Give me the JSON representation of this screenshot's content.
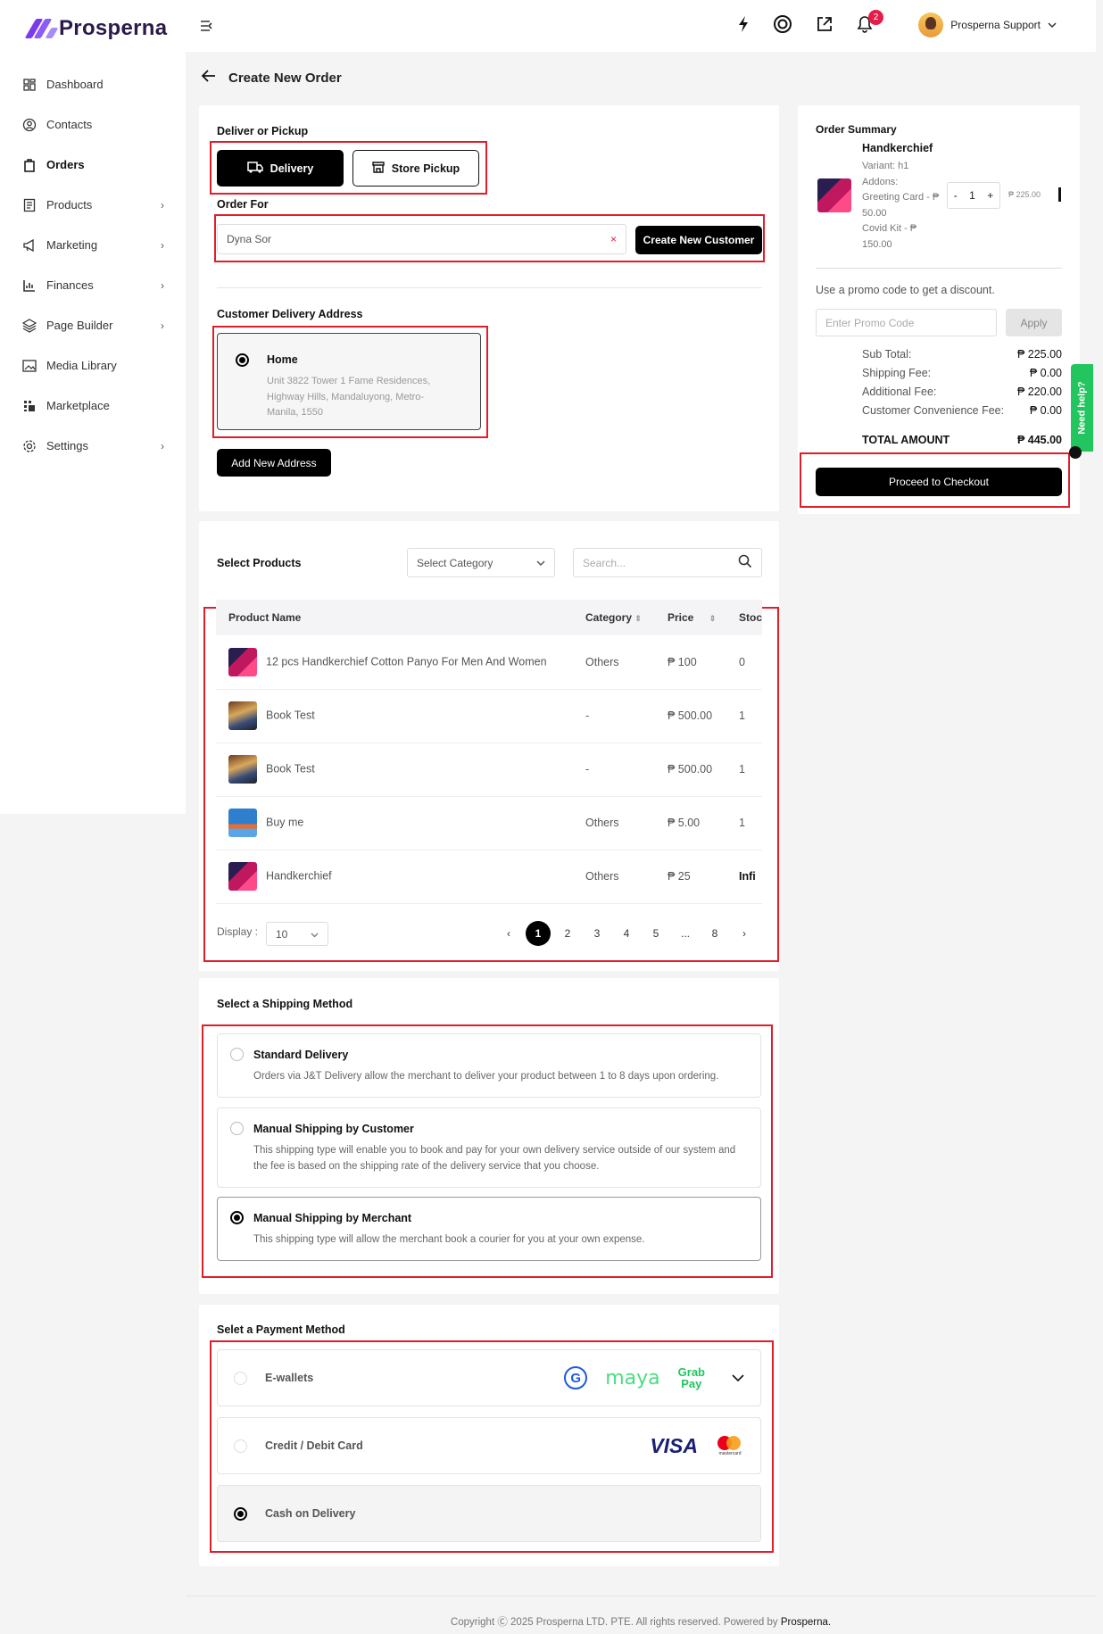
{
  "brand": {
    "name": "Prosperna"
  },
  "sidebar": {
    "items": [
      {
        "label": "Dashboard",
        "icon": "dashboard-icon",
        "chevron": false
      },
      {
        "label": "Contacts",
        "icon": "contacts-icon",
        "chevron": false
      },
      {
        "label": "Orders",
        "icon": "orders-icon",
        "chevron": false,
        "active": true
      },
      {
        "label": "Products",
        "icon": "products-icon",
        "chevron": true
      },
      {
        "label": "Marketing",
        "icon": "megaphone-icon",
        "chevron": true
      },
      {
        "label": "Finances",
        "icon": "chart-icon",
        "chevron": true
      },
      {
        "label": "Page Builder",
        "icon": "layers-icon",
        "chevron": true
      },
      {
        "label": "Media Library",
        "icon": "image-icon",
        "chevron": false
      },
      {
        "label": "Marketplace",
        "icon": "grid-icon",
        "chevron": false
      },
      {
        "label": "Settings",
        "icon": "gear-icon",
        "chevron": true
      }
    ]
  },
  "topbar": {
    "notification_count": "2",
    "user_name": "Prosperna Support"
  },
  "page": {
    "title": "Create New Order"
  },
  "deliver": {
    "title": "Deliver or Pickup",
    "delivery_label": "Delivery",
    "pickup_label": "Store Pickup",
    "order_for_title": "Order For",
    "customer_value": "Dyna Sor",
    "create_customer_label": "Create New Customer",
    "address_title": "Customer Delivery Address",
    "address_name": "Home",
    "address_text": "Unit 3822 Tower 1 Fame Residences, Highway Hills, Mandaluyong, Metro-Manila, 1550",
    "add_address_label": "Add New Address"
  },
  "products": {
    "title": "Select Products",
    "category_placeholder": "Select Category",
    "search_placeholder": "Search...",
    "columns": [
      "Product Name",
      "Category",
      "Price",
      "Stoc"
    ],
    "rows": [
      {
        "name": "12 pcs Handkerchief Cotton Panyo For Men And Women",
        "category": "Others",
        "price": "₱ 100",
        "stock": "0",
        "thumb": "hk"
      },
      {
        "name": "Book Test",
        "category": "-",
        "price": "₱ 500.00",
        "stock": "1",
        "thumb": "book"
      },
      {
        "name": "Book Test",
        "category": "-",
        "price": "₱ 500.00",
        "stock": "1",
        "thumb": "book"
      },
      {
        "name": "Buy me",
        "category": "Others",
        "price": "₱ 5.00",
        "stock": "1",
        "thumb": "buy"
      },
      {
        "name": "Handkerchief",
        "category": "Others",
        "price": "₱ 25",
        "stock": "Infi",
        "thumb": "hk"
      }
    ],
    "display_label": "Display :",
    "display_value": "10",
    "pages": [
      "1",
      "2",
      "3",
      "4",
      "5",
      "...",
      "8"
    ],
    "prev": "‹",
    "next": "›"
  },
  "shipping": {
    "title": "Select a Shipping Method",
    "options": [
      {
        "title": "Standard Delivery",
        "desc": "Orders via J&T Delivery allow the merchant to deliver your product between 1 to 8 days upon ordering.",
        "selected": false
      },
      {
        "title": "Manual Shipping by Customer",
        "desc": "This shipping type will enable you to book and pay for your own delivery service outside of our system and the fee is based on the shipping rate of the delivery service that you choose.",
        "selected": false
      },
      {
        "title": "Manual Shipping by Merchant",
        "desc": "This shipping type will allow the merchant book a courier for you at your own expense.",
        "selected": true
      }
    ]
  },
  "payment": {
    "title": "Selet a Payment Method",
    "options": [
      {
        "label": "E-wallets",
        "logos": [
          "G",
          "maya",
          "Grab",
          "Pay"
        ]
      },
      {
        "label": "Credit / Debit Card",
        "logos": [
          "VISA",
          "mastercard"
        ]
      },
      {
        "label": "Cash on Delivery",
        "selected": true
      }
    ]
  },
  "summary": {
    "title": "Order Summary",
    "item_name": "Handkerchief",
    "variant": "Variant: h1",
    "addons_label": "Addons:",
    "addon_1": "Greeting Card - ₱ 50.00",
    "addon_2": "Covid Kit - ₱ 150.00",
    "qty": "1",
    "qty_minus": "-",
    "qty_plus": "+",
    "item_price": "₱ 225.00",
    "promo_hint": "Use a promo code to get a discount.",
    "promo_placeholder": "Enter Promo Code",
    "apply_label": "Apply",
    "rows": [
      {
        "label": "Sub Total:",
        "value": "₱ 225.00"
      },
      {
        "label": "Shipping Fee:",
        "value": "₱ 0.00"
      },
      {
        "label": "Additional Fee:",
        "value": "₱ 220.00"
      },
      {
        "label": "Customer Convenience Fee:",
        "value": "₱ 0.00"
      }
    ],
    "total_label": "TOTAL AMOUNT",
    "total_value": "₱ 445.00",
    "checkout_label": "Proceed to Checkout"
  },
  "help": {
    "label": "Need help?"
  },
  "footer": {
    "text": "Copyright Ⓒ 2025 Prosperna LTD. PTE. All rights reserved. Powered by",
    "brand": "Prosperna."
  },
  "colors": {
    "accent": "#000000",
    "highlight": "#e11d2a",
    "brand": "#7c3aed",
    "help": "#22c55e"
  }
}
